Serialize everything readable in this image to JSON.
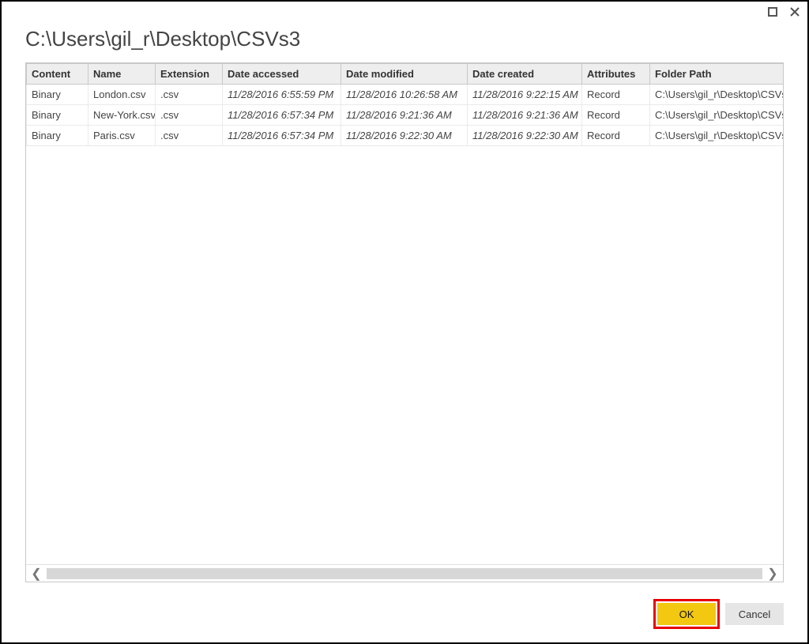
{
  "title": "C:\\Users\\gil_r\\Desktop\\CSVs3",
  "columns": {
    "content": "Content",
    "name": "Name",
    "extension": "Extension",
    "accessed": "Date accessed",
    "modified": "Date modified",
    "created": "Date created",
    "attributes": "Attributes",
    "folder": "Folder Path"
  },
  "rows": [
    {
      "content": "Binary",
      "name": "London.csv",
      "extension": ".csv",
      "accessed": "11/28/2016 6:55:59 PM",
      "modified": "11/28/2016 10:26:58 AM",
      "created": "11/28/2016 9:22:15 AM",
      "attributes": "Record",
      "folder": "C:\\Users\\gil_r\\Desktop\\CSVs"
    },
    {
      "content": "Binary",
      "name": "New-York.csv",
      "extension": ".csv",
      "accessed": "11/28/2016 6:57:34 PM",
      "modified": "11/28/2016 9:21:36 AM",
      "created": "11/28/2016 9:21:36 AM",
      "attributes": "Record",
      "folder": "C:\\Users\\gil_r\\Desktop\\CSVs"
    },
    {
      "content": "Binary",
      "name": "Paris.csv",
      "extension": ".csv",
      "accessed": "11/28/2016 6:57:34 PM",
      "modified": "11/28/2016 9:22:30 AM",
      "created": "11/28/2016 9:22:30 AM",
      "attributes": "Record",
      "folder": "C:\\Users\\gil_r\\Desktop\\CSVs"
    }
  ],
  "buttons": {
    "ok": "OK",
    "cancel": "Cancel"
  }
}
